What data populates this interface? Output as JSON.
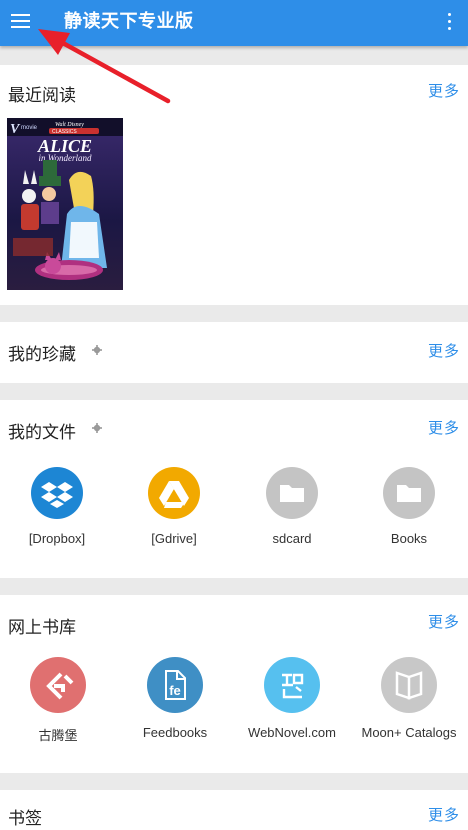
{
  "appbar": {
    "title": "静读天下专业版",
    "menu_icon": "hamburger-menu-icon",
    "overflow_icon": "more-vert-icon"
  },
  "recent": {
    "title": "最近阅读",
    "more": "更多",
    "book_cover_text": "Alice in Wonderland",
    "book_cover_brand": "Walt Disney",
    "book_cover_series": "VMovie Classics"
  },
  "favorites": {
    "title": "我的珍藏",
    "more": "更多",
    "settings_icon": "gear-icon"
  },
  "files": {
    "title": "我的文件",
    "more": "更多",
    "settings_icon": "gear-icon",
    "items": [
      {
        "label": "[Dropbox]",
        "icon": "dropbox-icon",
        "color": "#1d86d4"
      },
      {
        "label": "[Gdrive]",
        "icon": "google-drive-icon",
        "color": "#f2a900"
      },
      {
        "label": "sdcard",
        "icon": "folder-icon",
        "color": "#c4c4c4"
      },
      {
        "label": "Books",
        "icon": "folder-icon",
        "color": "#c4c4c4"
      }
    ]
  },
  "library": {
    "title": "网上书库",
    "more": "更多",
    "items": [
      {
        "label": "古腾堡",
        "icon": "gutenberg-icon",
        "color": "#e07070"
      },
      {
        "label": "Feedbooks",
        "icon": "feedbooks-icon",
        "color": "#3f8fc5"
      },
      {
        "label": "WebNovel.com",
        "icon": "webnovel-icon",
        "color": "#56c0ef"
      },
      {
        "label": "Moon+ Catalogs",
        "icon": "open-book-icon",
        "color": "#c8c8c8"
      }
    ]
  },
  "bookmarks": {
    "title": "书签",
    "more": "更多"
  },
  "colors": {
    "accent": "#2e8ee8",
    "background": "#eaeaea",
    "annotation_arrow": "#e8202a"
  }
}
